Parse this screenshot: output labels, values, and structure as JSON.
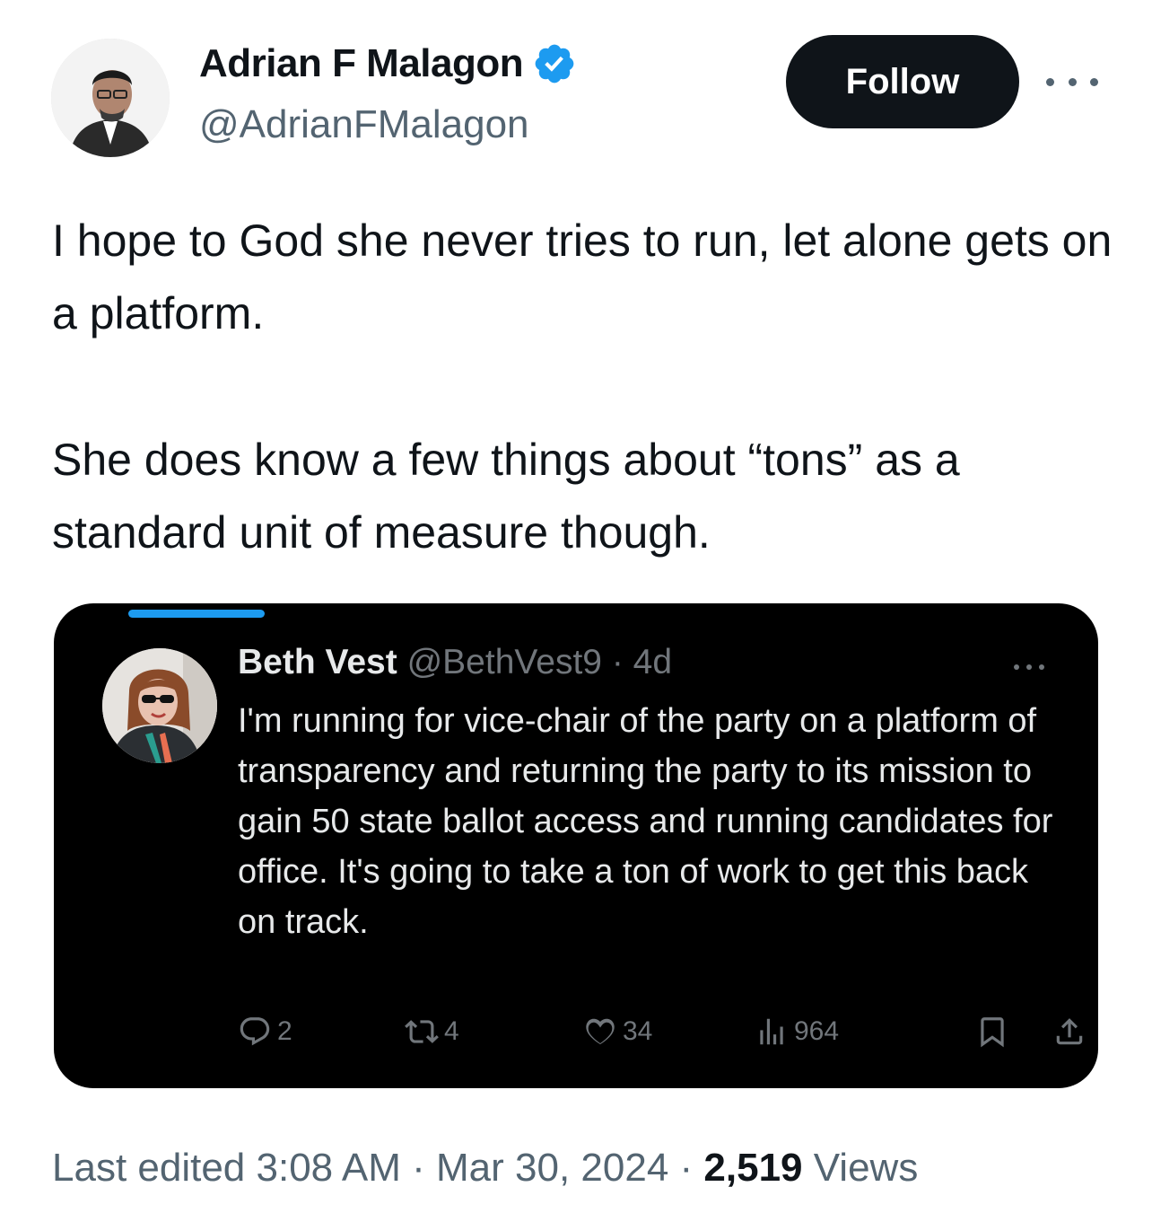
{
  "author": {
    "display_name": "Adrian F Malagon",
    "handle": "@AdrianFMalagon",
    "verified_icon": "verified-badge-icon"
  },
  "actions": {
    "follow_label": "Follow",
    "more_icon": "more-horizontal-icon"
  },
  "tweet": {
    "paragraphs": [
      "I hope to God she never tries to run, let alone gets on a platform.",
      "She does know a few things about “tons” as a standard unit of measure though."
    ]
  },
  "quoted": {
    "display_name": "Beth Vest",
    "handle": "@BethVest9",
    "separator": "·",
    "age": "4d",
    "text": "I'm running for vice-chair of the party on a platform of transparency and returning the party to its mission to gain 50 state ballot access and running candidates for office. It's going to take a ton of work to get this back on track.",
    "replies": "2",
    "reposts": "4",
    "likes": "34",
    "views": "964",
    "icons": [
      "reply-icon",
      "repost-icon",
      "like-icon",
      "views-icon",
      "bookmark-icon",
      "share-icon"
    ]
  },
  "footer": {
    "prefix": "Last edited 3:08 AM · Mar 30, 2024 · ",
    "views_count": "2,519",
    "views_label": " Views"
  },
  "colors": {
    "text_primary": "#0f1419",
    "text_secondary": "#536471",
    "brand_blue": "#1d9bf0",
    "dark_card": "#000000"
  }
}
